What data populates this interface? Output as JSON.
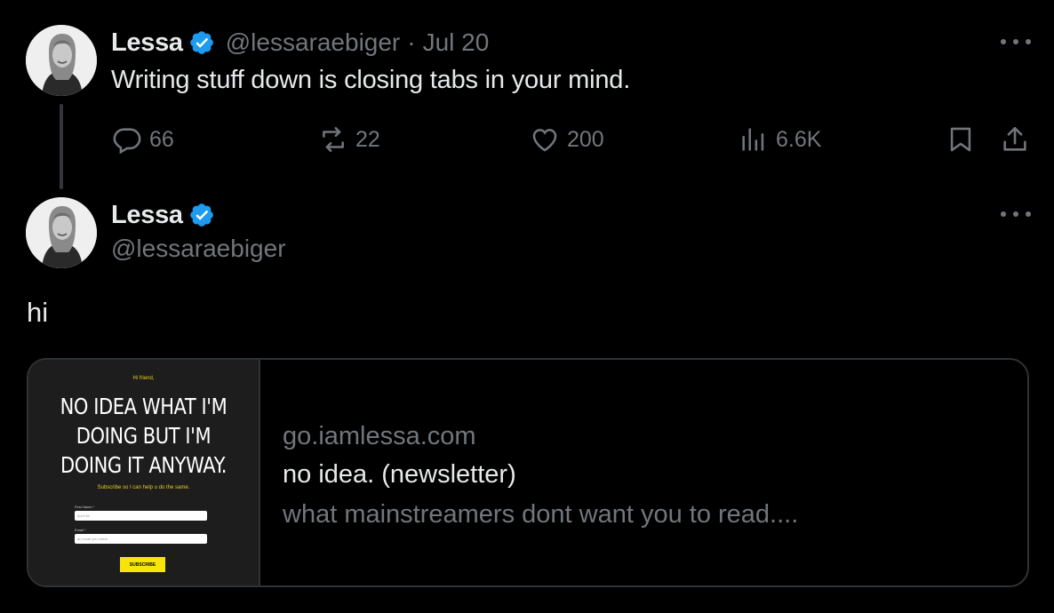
{
  "tweet1": {
    "author_name": "Lessa",
    "handle": "@lessaraebiger",
    "separator": "·",
    "date": "Jul 20",
    "text": "Writing stuff down is closing tabs in your mind.",
    "actions": {
      "reply_count": "66",
      "retweet_count": "22",
      "like_count": "200",
      "views_count": "6.6K"
    }
  },
  "tweet2": {
    "author_name": "Lessa",
    "handle": "@lessaraebiger",
    "text": "hi",
    "card": {
      "thumbnail": {
        "greeting": "Hi friend,",
        "headline_line1": "NO IDEA WHAT I'M",
        "headline_line2": "DOING BUT I'M",
        "headline_line3": "DOING IT ANYWAY.",
        "subline": "Subscribe so I can help u do the same.",
        "first_name_label": "First Name *",
        "first_name_placeholder": "don't lie",
        "email_label": "Email *",
        "email_placeholder": "an email you check",
        "button_label": "SUBSCRIBE"
      },
      "domain": "go.iamlessa.com",
      "title": "no idea. (newsletter)",
      "description": "what mainstreamers dont want you to read...."
    }
  },
  "colors": {
    "background": "#000000",
    "primary_text": "#e7e9ea",
    "secondary_text": "#71767b",
    "verified_badge": "#1d9bf0",
    "border": "#2f3336",
    "thumb_accent": "#f5e50a"
  },
  "icons": {
    "verified": "verified-badge-icon",
    "reply": "reply-icon",
    "retweet": "retweet-icon",
    "like": "heart-icon",
    "views": "views-chart-icon",
    "bookmark": "bookmark-icon",
    "share": "share-icon",
    "more": "more-options-icon"
  }
}
